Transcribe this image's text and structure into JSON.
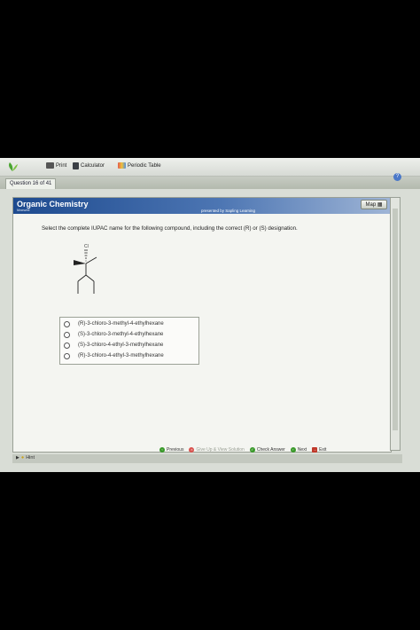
{
  "toolbar": {
    "print": "Print",
    "calculator": "Calculator",
    "periodic_table": "Periodic Table"
  },
  "question_tab": "Question 16 of 41",
  "banner": {
    "title": "Organic Chemistry",
    "subtitle": "Maxwell",
    "presented_by": "presented by Sapling Learning",
    "map_label": "Map"
  },
  "question_text": "Select the complete IUPAC name for the following compound, including the correct (R) or (S) designation.",
  "molecule": {
    "substituent_label": "Cl"
  },
  "options": [
    {
      "label": "(R)-3-chloro-3-methyl-4-ethylhexane"
    },
    {
      "label": "(S)-3-chloro-3-methyl-4-ethylhexane"
    },
    {
      "label": "(S)-3-chloro-4-ethyl-3-methylhexane"
    },
    {
      "label": "(R)-3-chloro-4-ethyl-3-methylhexane"
    }
  ],
  "footer": {
    "previous": "Previous",
    "give_up": "Give Up & View Solution",
    "check_answer": "Check Answer",
    "next": "Next",
    "exit": "Exit"
  },
  "hint": "Hint",
  "colors": {
    "banner": "#1d4a8f",
    "accent_green": "#3a9a2a",
    "exit_red": "#c0392b"
  }
}
